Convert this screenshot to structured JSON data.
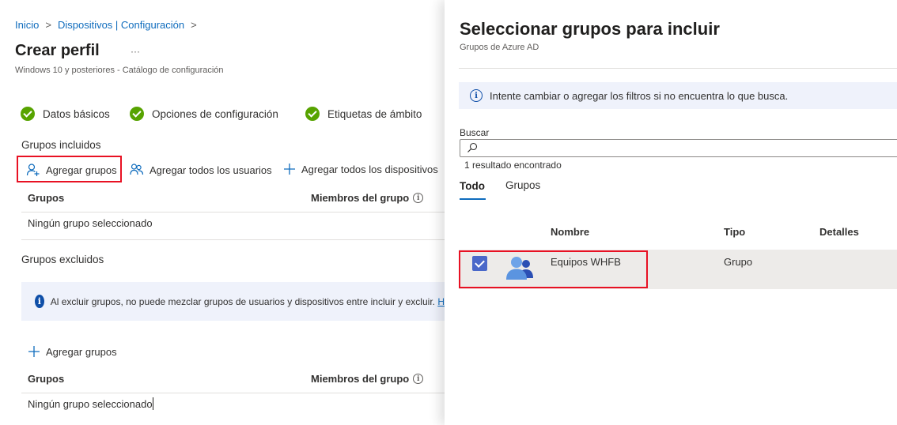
{
  "breadcrumb": {
    "items": [
      "Inicio",
      "Dispositivos | Configuración"
    ],
    "separator": ">"
  },
  "page": {
    "title": "Crear perfil",
    "more": "···",
    "subtitle": "Windows 10 y posteriores - Catálogo de configuración"
  },
  "steps": [
    "Datos básicos",
    "Opciones de configuración",
    "Etiquetas de ámbito"
  ],
  "included": {
    "label": "Grupos incluidos",
    "commands": {
      "add_groups": "Agregar grupos",
      "add_all_users": "Agregar todos los usuarios",
      "add_all_devices": "Agregar todos los dispositivos"
    },
    "columns": [
      "Grupos",
      "Miembros del grupo"
    ],
    "empty": "Ningún grupo seleccionado"
  },
  "excluded": {
    "label": "Grupos excluidos",
    "info": "Al excluir grupos, no puede mezclar grupos de usuarios y dispositivos entre incluir y excluir.",
    "info_link": "H",
    "add_groups": "Agregar grupos",
    "columns": [
      "Grupos",
      "Miembros del grupo"
    ],
    "empty": "Ningún grupo seleccionado"
  },
  "panel": {
    "title": "Seleccionar grupos para incluir",
    "subtitle": "Grupos de Azure AD",
    "info": "Intente cambiar o agregar los filtros si no encuentra lo que busca.",
    "search": {
      "label": "Buscar",
      "value": "",
      "placeholder": ""
    },
    "result_count": "1 resultado encontrado",
    "tabs": [
      "Todo",
      "Grupos"
    ],
    "active_tab": "Todo",
    "columns": [
      "Nombre",
      "Tipo",
      "Detalles"
    ],
    "rows": [
      {
        "name": "Equipos WHFB",
        "type": "Grupo",
        "details": "",
        "checked": true,
        "icon": "group-icon"
      }
    ]
  },
  "colors": {
    "accent": "#0f6cbd",
    "success": "#57a300",
    "highlight": "#e81123",
    "checkbox": "#4a68c9"
  }
}
